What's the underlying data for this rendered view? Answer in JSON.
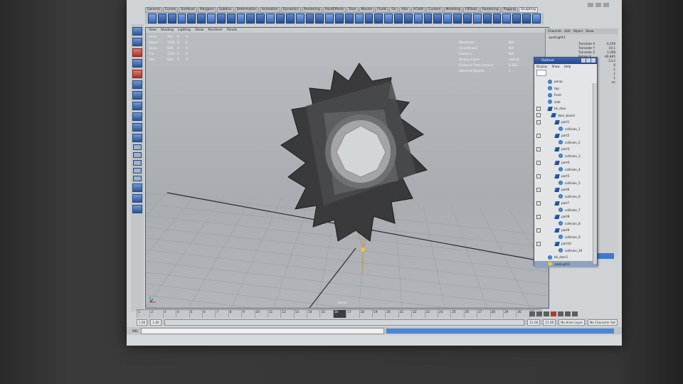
{
  "shelf_tabs": [
    "General",
    "Curves",
    "Surfaces",
    "Polygons",
    "Subdivs",
    "Deformation",
    "Animation",
    "Dynamics",
    "Rendering",
    "PaintEffects",
    "Toon",
    "Muscle",
    "Fluids",
    "Fur",
    "Hair",
    "nCloth",
    "Custom",
    "Modeling",
    "FBTools",
    "Rendering",
    "Rigging",
    "Sculpting"
  ],
  "viewport": {
    "menu": [
      "View",
      "Shading",
      "Lighting",
      "Show",
      "Renderer",
      "Panels"
    ],
    "hud_left_labels": [
      "Verts:",
      "Edges:",
      "Faces:",
      "Tris:",
      "UVs:"
    ],
    "hud_left_values": [
      [
        "782",
        "0",
        "0"
      ],
      [
        "1563",
        "0",
        "0"
      ],
      [
        "820",
        "0",
        "0"
      ],
      [
        "1520",
        "0",
        "0"
      ],
      [
        "834",
        "0",
        "0"
      ]
    ],
    "hud_right": [
      [
        "Backfaces:",
        "N/A"
      ],
      [
        "Smoothness:",
        "N/A"
      ],
      [
        "Instance:",
        "N/A"
      ],
      [
        "Display Layer:",
        "default"
      ],
      [
        "Distance From Camera:",
        "8.303"
      ],
      [
        "Selected Objects:",
        "1"
      ]
    ],
    "camera_label": "persp"
  },
  "outliner": {
    "title": "Outliner",
    "menu": [
      "Display",
      "Show",
      "Help"
    ],
    "items": [
      {
        "label": "persp",
        "icon": "camera-icon",
        "expand": false,
        "indent": 0
      },
      {
        "label": "top",
        "icon": "camera-icon",
        "expand": false,
        "indent": 0
      },
      {
        "label": "front",
        "icon": "camera-icon",
        "expand": false,
        "indent": 0
      },
      {
        "label": "side",
        "icon": "camera-icon",
        "expand": false,
        "indent": 0
      },
      {
        "label": "bk_door",
        "icon": "joint-icon",
        "expand": true,
        "indent": 0
      },
      {
        "label": "door_base1",
        "icon": "joint-icon",
        "expand": true,
        "indent": 1
      },
      {
        "label": "part1",
        "icon": "joint-icon",
        "expand": true,
        "indent": 2
      },
      {
        "label": "collision_1",
        "icon": "mesh-icon",
        "expand": false,
        "indent": 3
      },
      {
        "label": "part2",
        "icon": "joint-icon",
        "expand": true,
        "indent": 2
      },
      {
        "label": "collision_2",
        "icon": "mesh-icon",
        "expand": false,
        "indent": 3
      },
      {
        "label": "part3",
        "icon": "joint-icon",
        "expand": true,
        "indent": 2
      },
      {
        "label": "collision_3",
        "icon": "mesh-icon",
        "expand": false,
        "indent": 3
      },
      {
        "label": "part4",
        "icon": "joint-icon",
        "expand": true,
        "indent": 2
      },
      {
        "label": "collision_4",
        "icon": "mesh-icon",
        "expand": false,
        "indent": 3
      },
      {
        "label": "part5",
        "icon": "joint-icon",
        "expand": true,
        "indent": 2
      },
      {
        "label": "collision_5",
        "icon": "mesh-icon",
        "expand": false,
        "indent": 3
      },
      {
        "label": "part6",
        "icon": "joint-icon",
        "expand": true,
        "indent": 2
      },
      {
        "label": "collision_6",
        "icon": "mesh-icon",
        "expand": false,
        "indent": 3
      },
      {
        "label": "part7",
        "icon": "joint-icon",
        "expand": true,
        "indent": 2
      },
      {
        "label": "collision_7",
        "icon": "mesh-icon",
        "expand": false,
        "indent": 3
      },
      {
        "label": "part8",
        "icon": "joint-icon",
        "expand": true,
        "indent": 2
      },
      {
        "label": "collision_8",
        "icon": "mesh-icon",
        "expand": false,
        "indent": 3
      },
      {
        "label": "part9",
        "icon": "joint-icon",
        "expand": true,
        "indent": 2
      },
      {
        "label": "collision_9",
        "icon": "mesh-icon",
        "expand": false,
        "indent": 3
      },
      {
        "label": "part10",
        "icon": "joint-icon",
        "expand": true,
        "indent": 2
      },
      {
        "label": "collision_10",
        "icon": "mesh-icon",
        "expand": false,
        "indent": 3
      },
      {
        "label": "bk_door1",
        "icon": "mesh-icon",
        "expand": false,
        "indent": 0
      },
      {
        "label": "spotLight1",
        "icon": "light-icon",
        "expand": false,
        "indent": 0,
        "selected": true
      }
    ]
  },
  "channelbox": {
    "menu": [
      "Channels",
      "Edit",
      "Object",
      "Show"
    ],
    "object_name": "spotLight1",
    "attrs": [
      [
        "Translate X",
        "6.259"
      ],
      [
        "Translate Y",
        "10.1"
      ],
      [
        "Translate Z",
        "3.308"
      ],
      [
        "Rotate X",
        "-66.895"
      ],
      [
        "Rotate Y",
        "-13.2"
      ],
      [
        "Rotate Z",
        "0"
      ],
      [
        "Scale X",
        "1"
      ],
      [
        "Scale Y",
        "1"
      ],
      [
        "Scale Z",
        "1"
      ],
      [
        "Visibility",
        "on"
      ]
    ]
  },
  "timeline": {
    "ticks": [
      "1",
      "2",
      "3",
      "4",
      "5",
      "6",
      "7",
      "8",
      "9",
      "10",
      "11",
      "12",
      "13",
      "14",
      "15",
      "16",
      "17",
      "18",
      "19",
      "20",
      "21",
      "22",
      "23",
      "24",
      "25",
      "26",
      "27",
      "28",
      "29",
      "30",
      "31"
    ],
    "current_frame": "16",
    "range_start": "1.00",
    "range_inner_start": "1.00",
    "range_inner_end": "21.00",
    "range_end": "21.00",
    "anim_layer": "No Anim Layer",
    "character_set": "No Character Set"
  },
  "cmdline": {
    "label": "MEL"
  }
}
